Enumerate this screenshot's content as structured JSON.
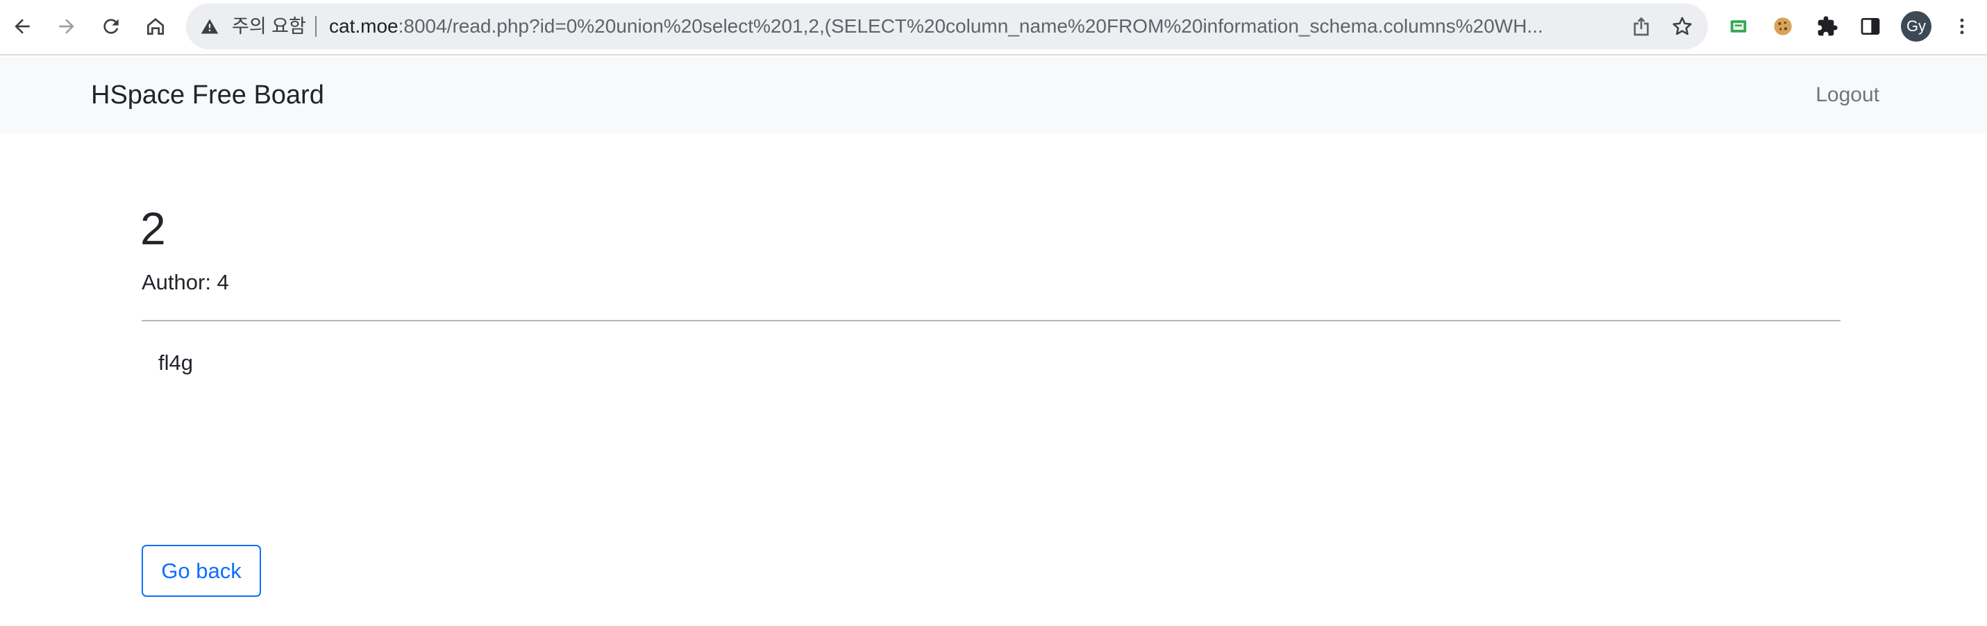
{
  "browser": {
    "security_label": "주의 요함",
    "url_host": "cat.moe",
    "url_rest": ":8004/read.php?id=0%20union%20select%201,2,(SELECT%20column_name%20FROM%20information_schema.columns%20WH...",
    "avatar_initials": "Gy",
    "icons": [
      "back-arrow-icon",
      "forward-arrow-icon",
      "reload-icon",
      "home-icon",
      "warning-icon",
      "share-icon",
      "star-icon",
      "screen-extension-icon",
      "cookie-icon",
      "puzzle-icon",
      "side-panel-icon",
      "more-vertical-icon"
    ]
  },
  "navbar": {
    "brand": "HSpace Free Board",
    "logout": "Logout"
  },
  "post": {
    "title": "2",
    "author": "Author: 4",
    "content": "fl4g"
  },
  "actions": {
    "back_label": "Go back"
  },
  "colors": {
    "navbar_bg": "#f8f9fa",
    "primary": "#0d6efd",
    "text": "#212529",
    "muted": "#6c757d"
  }
}
